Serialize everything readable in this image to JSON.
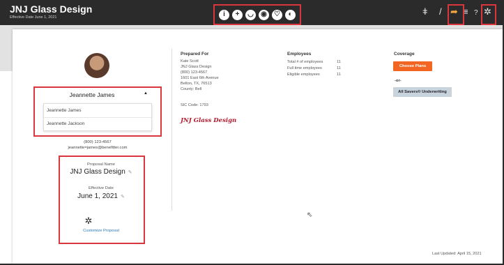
{
  "app": {
    "title": "JNJ Glass Design",
    "subtitle": "Effective Date June 1, 2021"
  },
  "toolbar_center": {
    "icons": [
      {
        "name": "info-icon",
        "glyph": "i"
      },
      {
        "name": "add-icon",
        "glyph": "+"
      },
      {
        "name": "dental-icon",
        "glyph": "◡"
      },
      {
        "name": "vision-icon",
        "glyph": "◉"
      },
      {
        "name": "benefits-icon",
        "glyph": "♡"
      },
      {
        "name": "globe-icon",
        "glyph": "◐"
      }
    ]
  },
  "toolbar_right": {
    "icons": [
      {
        "name": "people-icon",
        "glyph": "ǂ"
      },
      {
        "name": "edit-icon",
        "glyph": "/"
      },
      {
        "name": "share-icon",
        "glyph": "➦"
      },
      {
        "name": "menu-icon",
        "glyph": "≡"
      },
      {
        "name": "help-icon",
        "glyph": "?"
      },
      {
        "name": "settings-icon",
        "glyph": "✲"
      }
    ]
  },
  "profile": {
    "selected_user": "Jeannette James",
    "dropdown_options": [
      "Jeannette James",
      "Jeannette Jackson"
    ],
    "phone": "(800) 123-4567",
    "email": "jeannette=james@benefitter.com"
  },
  "proposal": {
    "name_label": "Proposal Name",
    "name": "JNJ Glass Design",
    "date_label": "Effective Date",
    "date": "June 1, 2021",
    "customize_label": "Customize Proposal"
  },
  "prepared_for": {
    "heading": "Prepared For",
    "lines": [
      "Kate Scott",
      "JNJ Glass Design",
      "(800) 123-4567",
      "1601 East 6th Avenue",
      "Belton, TX, 76513",
      "County: Bell"
    ],
    "sic": "SIC Code: 1793",
    "signature": "JNJ Glass Design"
  },
  "employees": {
    "heading": "Employees",
    "rows": [
      {
        "label": "Total # of employees",
        "value": "11"
      },
      {
        "label": "Full time employees",
        "value": "11"
      },
      {
        "label": "Eligible employees",
        "value": "11"
      }
    ]
  },
  "coverage": {
    "heading": "Coverage",
    "choose_label": "Choose Plans",
    "or_label": "-or-",
    "underwriting_label": "All Savers® Underwriting"
  },
  "footer": {
    "last_updated": "Last Updated: April 15, 2021"
  },
  "colors": {
    "highlight": "#d9363e",
    "accent_orange": "#f26522",
    "topbar": "#2b2b2b",
    "signature": "#b0192b"
  }
}
